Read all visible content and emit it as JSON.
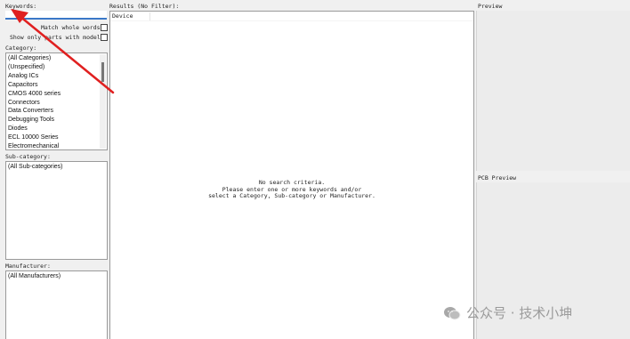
{
  "left": {
    "keywords_label": "Keywords:",
    "keywords_value": "",
    "match_whole_words_label": "Match whole words?",
    "show_only_models_label": "Show only parts with models?",
    "category_label": "Category:",
    "categories": [
      "(All Categories)",
      "(Unspecified)",
      "Analog ICs",
      "Capacitors",
      "CMOS 4000 series",
      "Connectors",
      "Data Converters",
      "Debugging Tools",
      "Diodes",
      "ECL 10000 Series",
      "Electromechanical"
    ],
    "subcategory_label": "Sub-category:",
    "subcategories": [
      "(All Sub-categories)"
    ],
    "manufacturer_label": "Manufacturer:",
    "manufacturers": [
      "(All Manufacturers)"
    ]
  },
  "results": {
    "label": "Results (No Filter):",
    "column_device": "Device",
    "empty_line1": "No search criteria.",
    "empty_line2": "Please enter one or more keywords and/or",
    "empty_line3": "select a Category, Sub-category or Manufacturer."
  },
  "preview": {
    "label": "Preview",
    "pcb_label": "PCB Preview"
  },
  "watermark": {
    "text": "公众号 · 技术小坤"
  },
  "colors": {
    "arrow": "#e02020",
    "background": "#f0f0f0",
    "panel": "#ffffff",
    "keyword_underline": "#3a78c8"
  }
}
